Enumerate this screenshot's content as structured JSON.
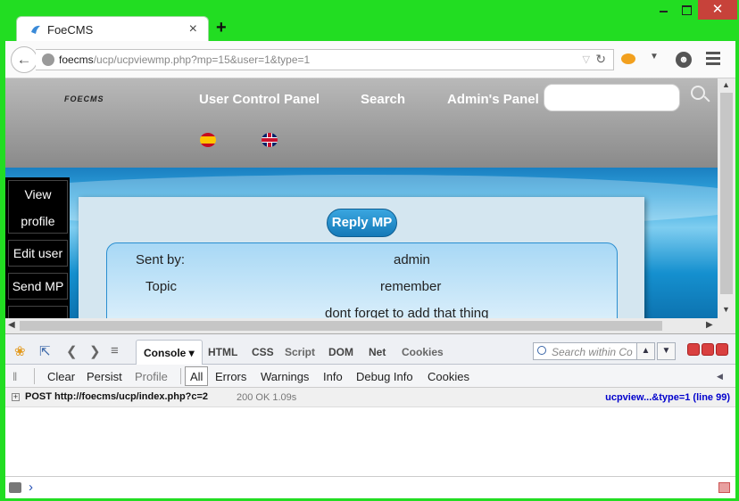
{
  "browser": {
    "tab_title": "FoeCMS",
    "tab_close": "×",
    "new_tab": "+",
    "window_close": "✕",
    "url_host": "foecms",
    "url_path": "/ucp/ucpviewmp.php?mp=15&user=1&type=1"
  },
  "site": {
    "logo": "FOECMS",
    "menu": [
      "User Control Panel",
      "Search",
      "Admin's Panel"
    ],
    "flags": [
      "spanish-flag",
      "uk-flag"
    ],
    "sidebar": [
      "View profile",
      "Edit user",
      "Send MP"
    ]
  },
  "message": {
    "reply_button": "Reply MP",
    "sent_by_label": "Sent by:",
    "sent_by_value": "admin",
    "topic_label": "Topic",
    "topic_value": "remember",
    "body": "dont forget to add that thing"
  },
  "firebug": {
    "tabs": [
      "Console",
      "HTML",
      "CSS",
      "Script",
      "DOM",
      "Net",
      "Cookies"
    ],
    "search_placeholder": "Search within Co",
    "toolbar": [
      "Clear",
      "Persist",
      "Profile",
      "All",
      "Errors",
      "Warnings",
      "Info",
      "Debug Info",
      "Cookies"
    ],
    "log": {
      "request": "POST http://foecms/ucp/index.php?c=2",
      "status": "200 OK 1.09s",
      "source": "ucpview...&type=1 (line 99)"
    },
    "prompt": "›"
  },
  "colors": {
    "window_frame": "#22dd22",
    "page_blue": "#138fce",
    "header_gray": "#8a8a8a",
    "close_red": "#c7423a"
  }
}
